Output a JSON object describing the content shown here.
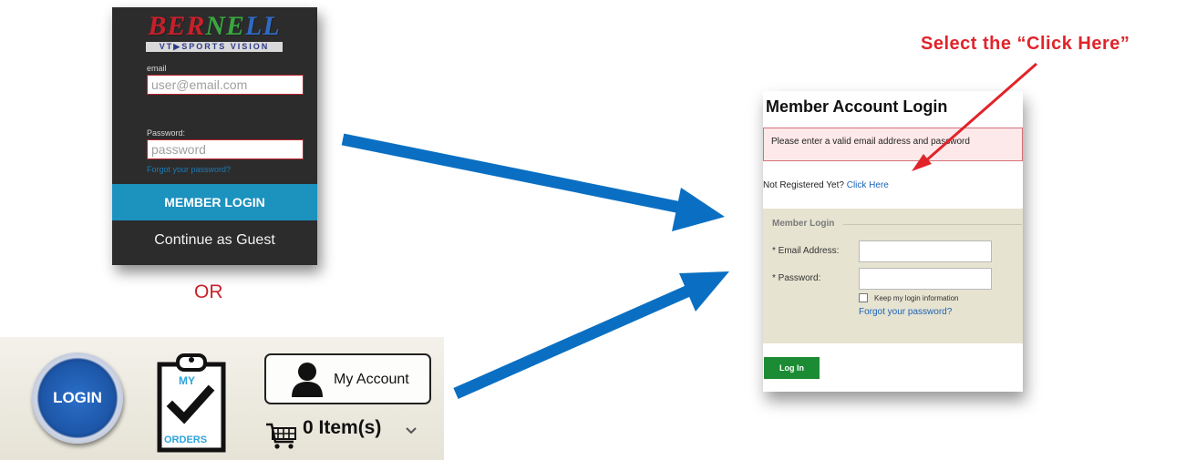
{
  "bernell_panel": {
    "logo_text": "BERNELL",
    "logo_tagline": "VT▶SPORTS VISION",
    "email_label": "email",
    "email_placeholder": "user@email.com",
    "password_label": "Password:",
    "password_placeholder": "password",
    "forgot_password": "Forgot your password?",
    "member_login_button": "MEMBER LOGIN",
    "guest_link": "Continue as Guest"
  },
  "or_label": "OR",
  "toolbar": {
    "login_button": "LOGIN",
    "orders_icon": {
      "top": "MY",
      "bottom": "ORDERS"
    },
    "account_button": "My Account",
    "cart_label": "0 Item(s)"
  },
  "member_login": {
    "title": "Member Account Login",
    "error_message": "Please enter a valid email address and password",
    "not_registered_text": "Not Registered Yet? ",
    "click_here": "Click Here",
    "section_legend": "Member Login",
    "email_label": "* Email Address:",
    "password_label": "* Password:",
    "keep_login": "Keep my login information",
    "forgot_password": "Forgot your password?",
    "login_button": "Log In"
  },
  "annotation": "Select the “Click Here”",
  "colors": {
    "arrow_blue": "#0a6fc2",
    "annotation_red": "#e0242a",
    "bernell_blue_button": "#1c92be",
    "login_green": "#1c8c34"
  }
}
